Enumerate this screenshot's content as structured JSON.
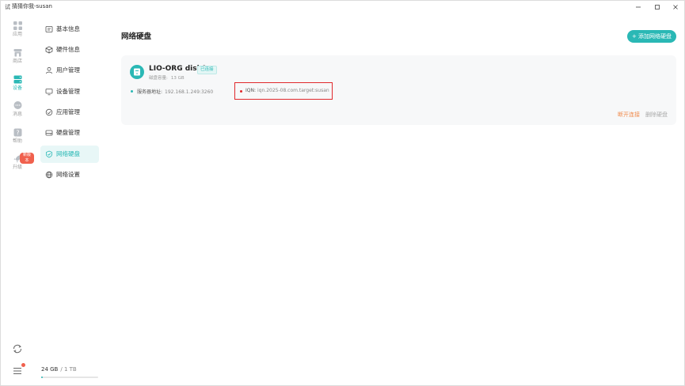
{
  "window": {
    "title": "猜猜你我-susan",
    "app_icon": "试"
  },
  "rail": {
    "items": [
      {
        "label": "应用",
        "icon": "grid-icon"
      },
      {
        "label": "商店",
        "icon": "store-icon"
      },
      {
        "label": "设备",
        "icon": "device-icon"
      },
      {
        "label": "消息",
        "icon": "message-icon"
      },
      {
        "label": "帮助",
        "icon": "help-icon"
      },
      {
        "label": "升级",
        "icon": "rocket-icon",
        "badge": "新版本"
      }
    ]
  },
  "sidebar": {
    "items": [
      {
        "label": "基本信息",
        "icon": "info-icon"
      },
      {
        "label": "硬件信息",
        "icon": "cube-icon"
      },
      {
        "label": "用户管理",
        "icon": "user-icon"
      },
      {
        "label": "设备管理",
        "icon": "monitor-icon"
      },
      {
        "label": "应用管理",
        "icon": "app-manage-icon"
      },
      {
        "label": "硬盘管理",
        "icon": "harddisk-icon"
      },
      {
        "label": "网络硬盘",
        "icon": "network-disk-icon"
      },
      {
        "label": "网络设置",
        "icon": "globe-icon"
      }
    ],
    "active_index": 6
  },
  "storage": {
    "used": "24 GB",
    "total": "/ 1 TB",
    "fraction": 0.024
  },
  "main": {
    "title": "网络硬盘",
    "add_button": "+ 添加网络硬盘"
  },
  "disk": {
    "name": "LIO-ORG disk0",
    "status": "已连接",
    "capacity_label": "磁盘容量:",
    "capacity_value": "13 GB",
    "address_label": "服务器地址:",
    "address_value": "192.168.1.249:3260",
    "iqn_label": "IQN:",
    "iqn_value": "iqn.2025-08.com.target:susan",
    "disconnect": "断开连接",
    "delete": "删除硬盘"
  },
  "colors": {
    "accent": "#2ab8b5",
    "danger": "#f08a4b",
    "badge": "#f0604d",
    "highlight_box": "#e0282c"
  }
}
